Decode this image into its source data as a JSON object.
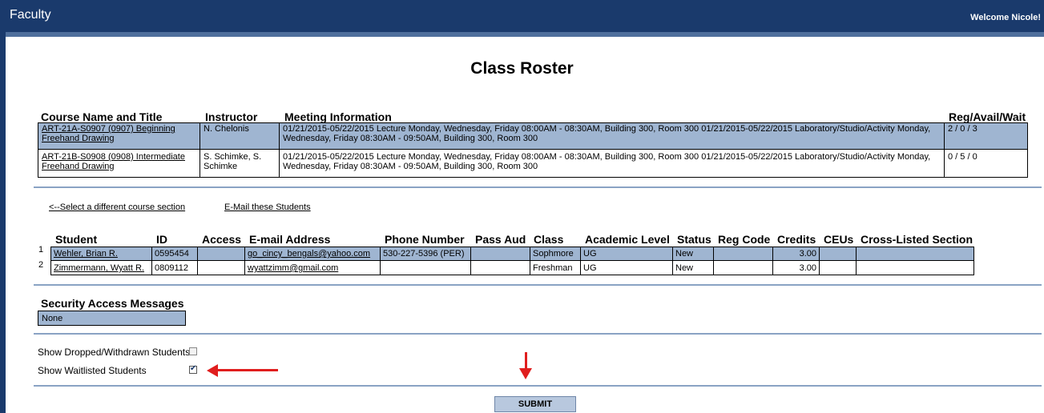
{
  "app": {
    "title": "Faculty",
    "welcome": "Welcome Nicole!"
  },
  "page": {
    "title": "Class Roster"
  },
  "course_table": {
    "headers": {
      "course": "Course Name and Title",
      "instructor": "Instructor",
      "meeting": "Meeting Information",
      "reg": "Reg/Avail/Wait"
    },
    "rows": [
      {
        "course": "ART-21A-S0907 (0907) Beginning Freehand Drawing",
        "instructor": "N. Chelonis",
        "meeting": "01/21/2015-05/22/2015 Lecture Monday, Wednesday, Friday 08:00AM - 08:30AM, Building 300, Room 300 01/21/2015-05/22/2015 Laboratory/Studio/Activity Monday, Wednesday, Friday 08:30AM - 09:50AM, Building 300, Room 300",
        "reg": "2 / 0 / 3"
      },
      {
        "course": "ART-21B-S0908 (0908) Intermediate Freehand Drawing",
        "instructor": "S. Schimke, S. Schimke",
        "meeting": "01/21/2015-05/22/2015 Lecture Monday, Wednesday, Friday 08:00AM - 08:30AM, Building 300, Room 300 01/21/2015-05/22/2015 Laboratory/Studio/Activity Monday, Wednesday, Friday 08:30AM - 09:50AM, Building 300, Room 300",
        "reg": "0 / 5 / 0"
      }
    ]
  },
  "links": {
    "select_section": "<--Select a different course section",
    "email": "E-Mail these Students"
  },
  "student_table": {
    "headers": {
      "student": "Student",
      "id": "ID",
      "access": "Access",
      "email": "E-mail Address",
      "phone": "Phone Number",
      "pass_aud": "Pass Aud",
      "class": "Class",
      "level": "Academic Level",
      "status": "Status",
      "reg_code": "Reg Code",
      "credits": "Credits",
      "ceus": "CEUs",
      "cross": "Cross-Listed Section"
    },
    "rows": [
      {
        "num": "1",
        "student": "Wehler, Brian R.",
        "id": "0595454",
        "access": "",
        "email": "go_cincy_bengals@yahoo.com",
        "phone": "530-227-5396 (PER)",
        "pass_aud": "",
        "class": "Sophmore",
        "level": "UG",
        "status": "New",
        "reg_code": "",
        "credits": "3.00",
        "ceus": "",
        "cross": ""
      },
      {
        "num": "2",
        "student": "Zimmermann, Wyatt R.",
        "id": "0809112",
        "access": "",
        "email": "wyattzimm@gmail.com",
        "phone": "",
        "pass_aud": "",
        "class": "Freshman",
        "level": "UG",
        "status": "New",
        "reg_code": "",
        "credits": "3.00",
        "ceus": "",
        "cross": ""
      }
    ]
  },
  "security": {
    "title": "Security Access Messages",
    "value": "None"
  },
  "options": {
    "dropped_label": "Show Dropped/Withdrawn Students",
    "dropped_checked": false,
    "waitlisted_label": "Show Waitlisted Students",
    "waitlisted_checked": true
  },
  "submit_label": "SUBMIT",
  "colors": {
    "header_bg": "#1a3a6c",
    "row_highlight": "#9fb5d1",
    "separator": "#8aa3c4",
    "annotation_arrow": "#e01e1e"
  }
}
